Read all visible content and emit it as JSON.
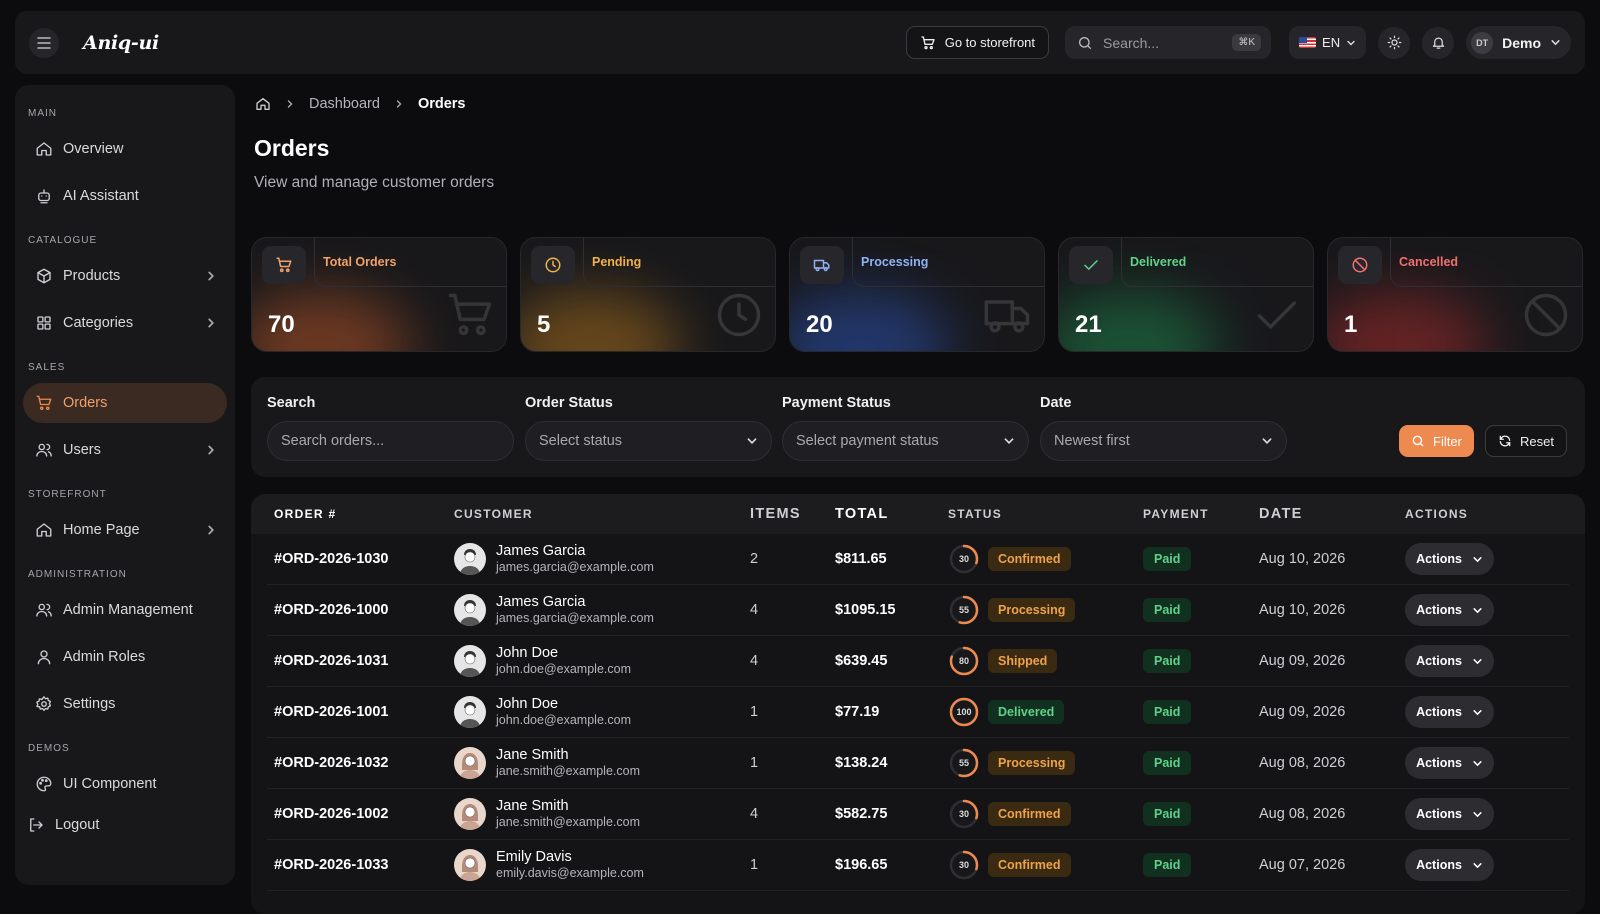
{
  "app": {
    "logo_text": "Aniq-ui"
  },
  "topbar": {
    "storefront_label": "Go to storefront",
    "search_placeholder": "Search...",
    "search_shortcut": "⌘K",
    "language": "EN",
    "user_initials": "DT",
    "user_name": "Demo"
  },
  "sidebar": {
    "sections": [
      {
        "label": "MAIN",
        "items": [
          {
            "label": "Overview",
            "icon": "home-icon"
          },
          {
            "label": "AI Assistant",
            "icon": "bot-icon"
          }
        ]
      },
      {
        "label": "CATALOGUE",
        "items": [
          {
            "label": "Products",
            "icon": "box-icon",
            "chevron": true
          },
          {
            "label": "Categories",
            "icon": "grid-icon",
            "chevron": true
          }
        ]
      },
      {
        "label": "SALES",
        "items": [
          {
            "label": "Orders",
            "icon": "cart-icon",
            "active": true
          },
          {
            "label": "Users",
            "icon": "users-icon",
            "chevron": true
          }
        ]
      },
      {
        "label": "STOREFRONT",
        "items": [
          {
            "label": "Home Page",
            "icon": "home-icon",
            "chevron": true
          }
        ]
      },
      {
        "label": "ADMINISTRATION",
        "items": [
          {
            "label": "Admin Management",
            "icon": "users-icon"
          },
          {
            "label": "Admin Roles",
            "icon": "user-icon"
          },
          {
            "label": "Settings",
            "icon": "gear-icon"
          }
        ]
      },
      {
        "label": "DEMOS",
        "items": [
          {
            "label": "UI Component",
            "icon": "palette-icon"
          }
        ]
      }
    ],
    "logout_label": "Logout"
  },
  "breadcrumb": {
    "items": [
      "Dashboard",
      "Orders"
    ]
  },
  "page": {
    "title": "Orders",
    "subtitle": "View and manage customer orders"
  },
  "stats": [
    {
      "label": "Total Orders",
      "value": "70",
      "icon": "cart-icon",
      "color": "#f0a36c",
      "glow": "#d4622c"
    },
    {
      "label": "Pending",
      "value": "5",
      "icon": "clock-icon",
      "color": "#f0b24a",
      "glow": "#c8821e"
    },
    {
      "label": "Processing",
      "value": "20",
      "icon": "truck-icon",
      "color": "#8fb2f4",
      "glow": "#2f5fd0"
    },
    {
      "label": "Delivered",
      "value": "21",
      "icon": "check-icon",
      "color": "#5fd28a",
      "glow": "#1f9a55"
    },
    {
      "label": "Cancelled",
      "value": "1",
      "icon": "ban-icon",
      "color": "#f07070",
      "glow": "#c23030"
    }
  ],
  "filters": {
    "search": {
      "label": "Search",
      "placeholder": "Search orders..."
    },
    "order_status": {
      "label": "Order Status",
      "value": "Select status"
    },
    "payment_status": {
      "label": "Payment Status",
      "value": "Select payment status"
    },
    "date": {
      "label": "Date",
      "value": "Newest first"
    },
    "filter_button": "Filter",
    "reset_button": "Reset"
  },
  "table": {
    "columns": [
      "ORDER #",
      "CUSTOMER",
      "ITEMS",
      "TOTAL",
      "STATUS",
      "PAYMENT",
      "DATE",
      "ACTIONS"
    ],
    "rows": [
      {
        "order": "#ORD-2026-1030",
        "name": "James Garcia",
        "email": "james.garcia@example.com",
        "gender": "m",
        "items": "2",
        "total": "$811.65",
        "progress": 30,
        "status": "Confirmed",
        "payment": "Paid",
        "date": "Aug 10, 2026",
        "action": "Actions"
      },
      {
        "order": "#ORD-2026-1000",
        "name": "James Garcia",
        "email": "james.garcia@example.com",
        "gender": "m",
        "items": "4",
        "total": "$1095.15",
        "progress": 55,
        "status": "Processing",
        "payment": "Paid",
        "date": "Aug 10, 2026",
        "action": "Actions"
      },
      {
        "order": "#ORD-2026-1031",
        "name": "John Doe",
        "email": "john.doe@example.com",
        "gender": "m",
        "items": "4",
        "total": "$639.45",
        "progress": 80,
        "status": "Shipped",
        "payment": "Paid",
        "date": "Aug 09, 2026",
        "action": "Actions"
      },
      {
        "order": "#ORD-2026-1001",
        "name": "John Doe",
        "email": "john.doe@example.com",
        "gender": "m",
        "items": "1",
        "total": "$77.19",
        "progress": 100,
        "status": "Delivered",
        "payment": "Paid",
        "date": "Aug 09, 2026",
        "action": "Actions"
      },
      {
        "order": "#ORD-2026-1032",
        "name": "Jane Smith",
        "email": "jane.smith@example.com",
        "gender": "f",
        "items": "1",
        "total": "$138.24",
        "progress": 55,
        "status": "Processing",
        "payment": "Paid",
        "date": "Aug 08, 2026",
        "action": "Actions"
      },
      {
        "order": "#ORD-2026-1002",
        "name": "Jane Smith",
        "email": "jane.smith@example.com",
        "gender": "f",
        "items": "4",
        "total": "$582.75",
        "progress": 30,
        "status": "Confirmed",
        "payment": "Paid",
        "date": "Aug 08, 2026",
        "action": "Actions"
      },
      {
        "order": "#ORD-2026-1033",
        "name": "Emily Davis",
        "email": "emily.davis@example.com",
        "gender": "f",
        "items": "1",
        "total": "$196.65",
        "progress": 30,
        "status": "Confirmed",
        "payment": "Paid",
        "date": "Aug 07, 2026",
        "action": "Actions"
      }
    ]
  },
  "status_colors": {
    "Confirmed": {
      "bg": "#3a2a12",
      "fg": "#f0a24a"
    },
    "Processing": {
      "bg": "#3a2a12",
      "fg": "#f0a24a"
    },
    "Shipped": {
      "bg": "#3a2a12",
      "fg": "#f0a24a"
    },
    "Delivered": {
      "bg": "#12301f",
      "fg": "#5fd28a"
    }
  },
  "accent": "#ee8a4f"
}
